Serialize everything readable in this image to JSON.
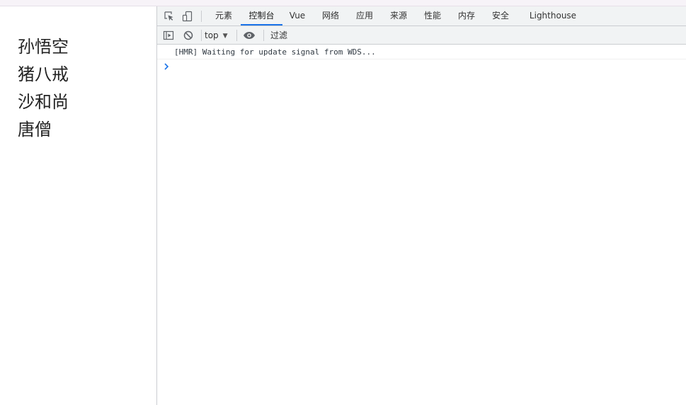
{
  "page": {
    "items": [
      "孙悟空",
      "猪八戒",
      "沙和尚",
      "唐僧"
    ]
  },
  "devtools": {
    "tabs": [
      {
        "label": "元素",
        "active": false
      },
      {
        "label": "控制台",
        "active": true
      },
      {
        "label": "Vue",
        "active": false
      },
      {
        "label": "网络",
        "active": false
      },
      {
        "label": "应用",
        "active": false
      },
      {
        "label": "来源",
        "active": false
      },
      {
        "label": "性能",
        "active": false
      },
      {
        "label": "内存",
        "active": false
      },
      {
        "label": "安全",
        "active": false
      },
      {
        "label": "Lighthouse",
        "active": false
      }
    ],
    "console_toolbar": {
      "context": "top",
      "filter_placeholder": "过滤"
    },
    "console": {
      "messages": [
        "[HMR] Waiting for update signal from WDS..."
      ],
      "prompt_symbol": "›"
    },
    "colors": {
      "accent": "#1a73e8",
      "toolbar_bg": "#f1f3f4",
      "border": "#cbcdd1"
    },
    "icons": {
      "inspect": "inspect-element-icon",
      "device": "device-toolbar-icon",
      "sidebar": "show-sidebar-icon",
      "clear": "clear-console-icon",
      "live_expression": "eye-icon",
      "prompt": "prompt-chevron-icon"
    }
  }
}
